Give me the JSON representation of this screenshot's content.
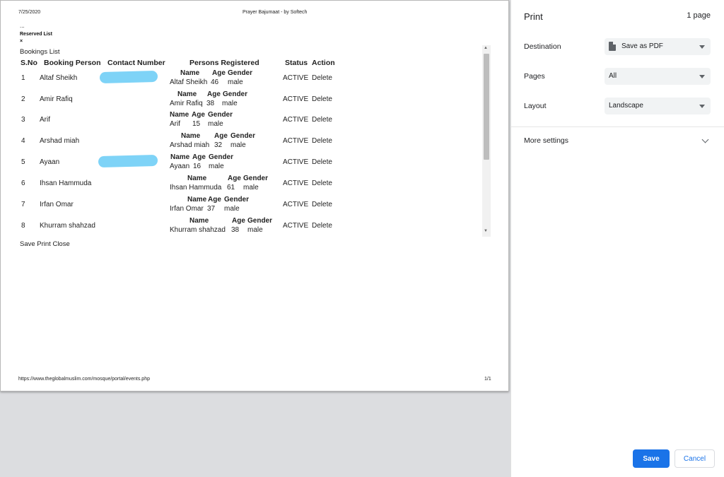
{
  "page": {
    "header_date": "7/25/2020",
    "header_title": "Prayer Bajumaat - by Softech",
    "dots": "...",
    "reserved_list": "Reserved List",
    "close_x": "×",
    "bookings_list": "Bookings List",
    "columns": {
      "sno": "S.No",
      "booking_person": "Booking Person",
      "contact_number": "Contact Number",
      "persons_registered": "Persons Registered",
      "status": "Status",
      "action": "Action"
    },
    "rows": [
      {
        "sno": "1",
        "person": "Altaf Sheikh",
        "h_name": "Name",
        "h_age": "Age",
        "h_gender": "Gender",
        "reg_name": "Altaf Sheikh",
        "reg_age": "46",
        "reg_gender": "male",
        "status": "ACTIVE",
        "action": "Delete"
      },
      {
        "sno": "2",
        "person": "Amir Rafiq",
        "h_name": "Name",
        "h_age": "Age",
        "h_gender": "Gender",
        "reg_name": "Amir Rafiq",
        "reg_age": "38",
        "reg_gender": "male",
        "status": "ACTIVE",
        "action": "Delete"
      },
      {
        "sno": "3",
        "person": "Arif",
        "h_name": "Name",
        "h_age": "Age",
        "h_gender": "Gender",
        "reg_name": "Arif",
        "reg_age": "15",
        "reg_gender": "male",
        "status": "ACTIVE",
        "action": "Delete"
      },
      {
        "sno": "4",
        "person": "Arshad miah",
        "h_name": "Name",
        "h_age": "Age",
        "h_gender": "Gender",
        "reg_name": "Arshad miah",
        "reg_age": "32",
        "reg_gender": "male",
        "status": "ACTIVE",
        "action": "Delete"
      },
      {
        "sno": "5",
        "person": "Ayaan",
        "h_name": "Name",
        "h_age": "Age",
        "h_gender": "Gender",
        "reg_name": "Ayaan",
        "reg_age": "16",
        "reg_gender": "male",
        "status": "ACTIVE",
        "action": "Delete"
      },
      {
        "sno": "6",
        "person": "Ihsan Hammuda",
        "h_name": "Name",
        "h_age": "Age",
        "h_gender": "Gender",
        "reg_name": "Ihsan Hammuda",
        "reg_age": "61",
        "reg_gender": "male",
        "status": "ACTIVE",
        "action": "Delete"
      },
      {
        "sno": "7",
        "person": "Irfan Omar",
        "h_name": "Name",
        "h_age": "Age",
        "h_gender": "Gender",
        "reg_name": "Irfan Omar",
        "reg_age": "37",
        "reg_gender": "male",
        "status": "ACTIVE",
        "action": "Delete"
      },
      {
        "sno": "8",
        "person": "Khurram shahzad",
        "h_name": "Name",
        "h_age": "Age",
        "h_gender": "Gender",
        "reg_name": "Khurram shahzad",
        "reg_age": "38",
        "reg_gender": "male",
        "status": "ACTIVE",
        "action": "Delete"
      }
    ],
    "footer_actions": "Save Print Close",
    "footer_url": "https://www.theglobalmuslim.com/mosque/portal/events.php",
    "footer_page": "1/1"
  },
  "print_panel": {
    "title": "Print",
    "page_count": "1 page",
    "destination_label": "Destination",
    "destination_value": "Save as PDF",
    "pages_label": "Pages",
    "pages_value": "All",
    "layout_label": "Layout",
    "layout_value": "Landscape",
    "more_settings": "More settings",
    "save_label": "Save",
    "cancel_label": "Cancel"
  },
  "colors": {
    "accent": "#1a73e8",
    "redaction": "#7ed3f7"
  }
}
